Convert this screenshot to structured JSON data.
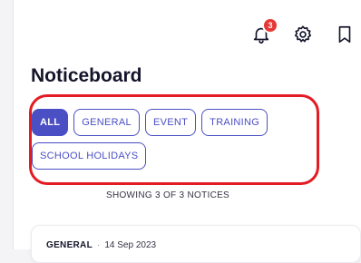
{
  "header": {
    "title": "Noticeboard",
    "notification_count": "3"
  },
  "icons": [
    "bell-icon",
    "gear-icon",
    "bookmark-icon"
  ],
  "filters": {
    "chips": [
      {
        "label": "ALL",
        "active": true
      },
      {
        "label": "GENERAL",
        "active": false
      },
      {
        "label": "EVENT",
        "active": false
      },
      {
        "label": "TRAINING",
        "active": false
      },
      {
        "label": "SCHOOL HOLIDAYS",
        "active": false
      }
    ]
  },
  "summary": {
    "text": "SHOWING 3 OF 3 NOTICES"
  },
  "notices": [
    {
      "category": "GENERAL",
      "separator": "·",
      "date": "14 Sep 2023"
    }
  ],
  "colors": {
    "accent": "#4b4fc4",
    "badge": "#e53935",
    "highlight": "#e31b23"
  }
}
